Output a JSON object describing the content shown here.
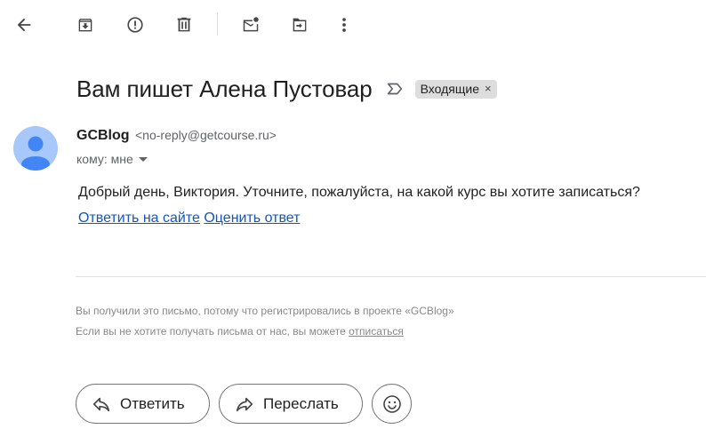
{
  "toolbar": {
    "icons": [
      "back-arrow-icon",
      "archive-icon",
      "report-spam-icon",
      "delete-icon",
      "mark-unread-icon",
      "move-to-icon",
      "more-vert-icon"
    ]
  },
  "email": {
    "subject": "Вам пишет Алена Пустовар",
    "label": "Входящие",
    "label_remove": "×",
    "sender_name": "GCBlog",
    "sender_email": "<no-reply@getcourse.ru>",
    "to_text": "кому: мне",
    "body_text": "Добрый день, Виктория. Уточните, пожалуйста, на какой курс вы хотите записаться?",
    "link_reply_site": "Ответить на сайте",
    "link_rate": "Оценить ответ",
    "footer_line1": "Вы получили это письмо, потому что регистрировались в проекте «GCBlog»",
    "footer_line2_prefix": "Если вы не хотите получать письма от нас, вы можете ",
    "footer_unsubscribe": "отписаться"
  },
  "actions": {
    "reply_label": "Ответить",
    "forward_label": "Переслать"
  },
  "colors": {
    "link": "#1155cc",
    "avatar_bg": "#a8c7fa",
    "avatar_fg": "#4285f4",
    "icon": "#444746"
  }
}
